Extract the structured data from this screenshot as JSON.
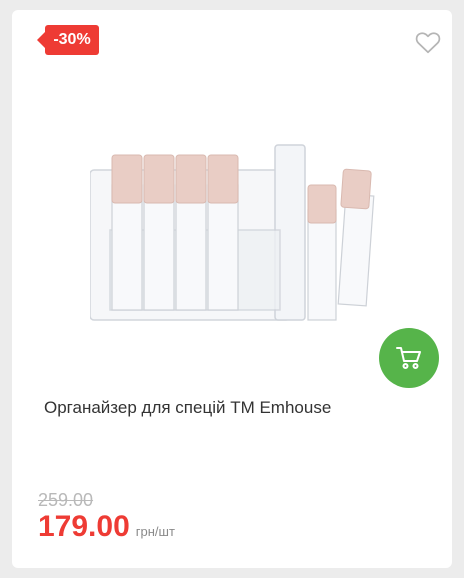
{
  "badge": {
    "text": "-30%"
  },
  "product": {
    "title": "Органайзер для спецій TM Emhouse",
    "old_price": "259.00",
    "price": "179.00",
    "unit": "грн/шт"
  },
  "icons": {
    "wishlist": "heart-icon",
    "cart": "cart-icon"
  },
  "colors": {
    "accent": "#ee3b34",
    "cart_button": "#56b44a",
    "old_price": "#b9b9b9"
  }
}
